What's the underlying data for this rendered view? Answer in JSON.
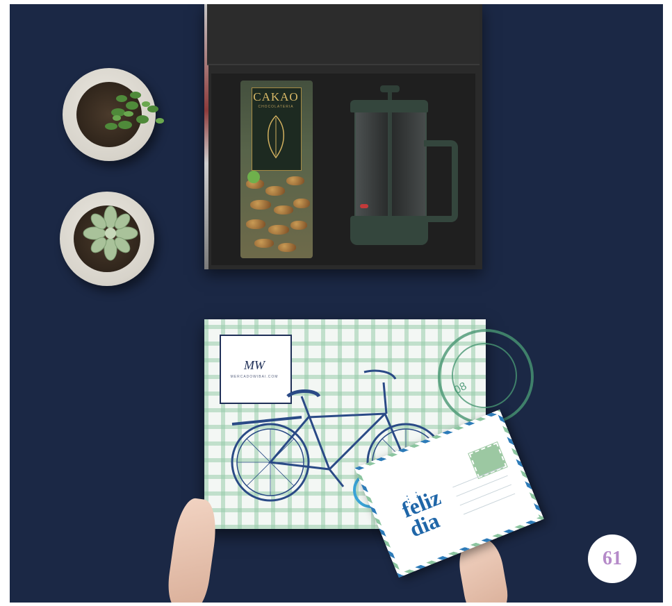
{
  "photo": {
    "package": {
      "brand_title": "CAKAO",
      "brand_subtitle": "CHOCOLATERIA"
    },
    "gift_lid": {
      "logo_mark": "MW",
      "logo_text": "MERCADOWIBAI.COM"
    },
    "postmark": {
      "text": "08"
    },
    "postcard": {
      "line1": "feliz",
      "line2": "dia"
    }
  },
  "page_number": "61",
  "colors": {
    "background": "#1b2845",
    "badge_text": "#b58ac9",
    "postcard_text": "#1f66a8"
  }
}
